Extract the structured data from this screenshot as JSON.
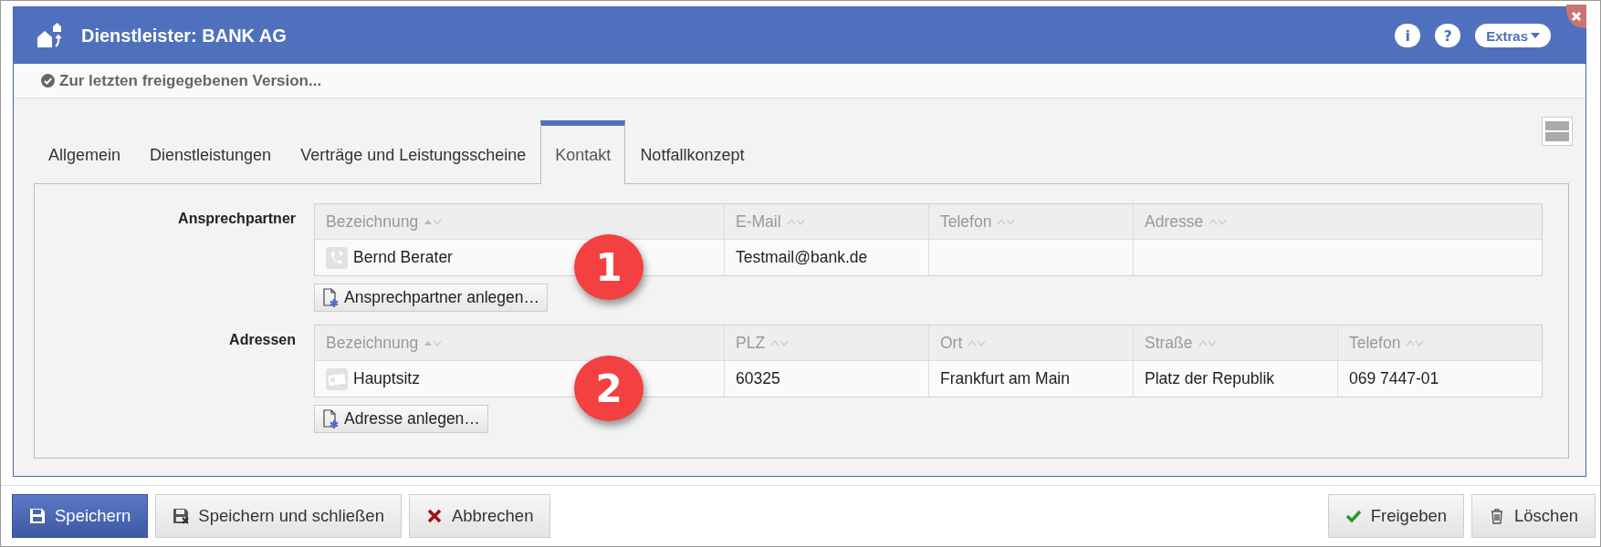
{
  "window": {
    "title": "Dienstleister: BANK AG",
    "info_button": "i",
    "help_button": "?",
    "extras_button": "Extras"
  },
  "version_link": "Zur letzten freigegebenen Version...",
  "tabs": [
    {
      "label": "Allgemein",
      "selected": false
    },
    {
      "label": "Dienstleistungen",
      "selected": false
    },
    {
      "label": "Verträge und Leistungsscheine",
      "selected": false
    },
    {
      "label": "Kontakt",
      "selected": true
    },
    {
      "label": "Notfallkonzept",
      "selected": false
    }
  ],
  "sections": [
    {
      "label": "Ansprechpartner",
      "columns": [
        {
          "label": "Bezeichnung",
          "sorted": true
        },
        {
          "label": "E-Mail",
          "sorted": false
        },
        {
          "label": "Telefon",
          "sorted": false
        },
        {
          "label": "Adresse",
          "sorted": false
        }
      ],
      "rows": [
        {
          "kind": "contact",
          "cells": [
            "Bernd Berater",
            "Testmail@bank.de",
            "",
            ""
          ]
        }
      ],
      "add_button": "Ansprechpartner anlegen…",
      "callout": "1"
    },
    {
      "label": "Adressen",
      "columns": [
        {
          "label": "Bezeichnung",
          "sorted": true
        },
        {
          "label": "PLZ",
          "sorted": false
        },
        {
          "label": "Ort",
          "sorted": false
        },
        {
          "label": "Straße",
          "sorted": false
        },
        {
          "label": "Telefon",
          "sorted": false
        }
      ],
      "rows": [
        {
          "kind": "address",
          "cells": [
            "Hauptsitz",
            "60325",
            "Frankfurt am Main",
            "Platz der Republik",
            "069 7447-01"
          ]
        }
      ],
      "add_button": "Adresse anlegen…",
      "callout": "2"
    }
  ],
  "footer": {
    "left_buttons": [
      {
        "label": "Speichern",
        "kind": "save",
        "primary": true
      },
      {
        "label": "Speichern und schließen",
        "kind": "save-close",
        "primary": false
      },
      {
        "label": "Abbrechen",
        "kind": "cancel",
        "primary": false
      }
    ],
    "right_buttons": [
      {
        "label": "Freigeben",
        "kind": "approve",
        "primary": false
      },
      {
        "label": "Löschen",
        "kind": "delete",
        "primary": false
      }
    ]
  }
}
